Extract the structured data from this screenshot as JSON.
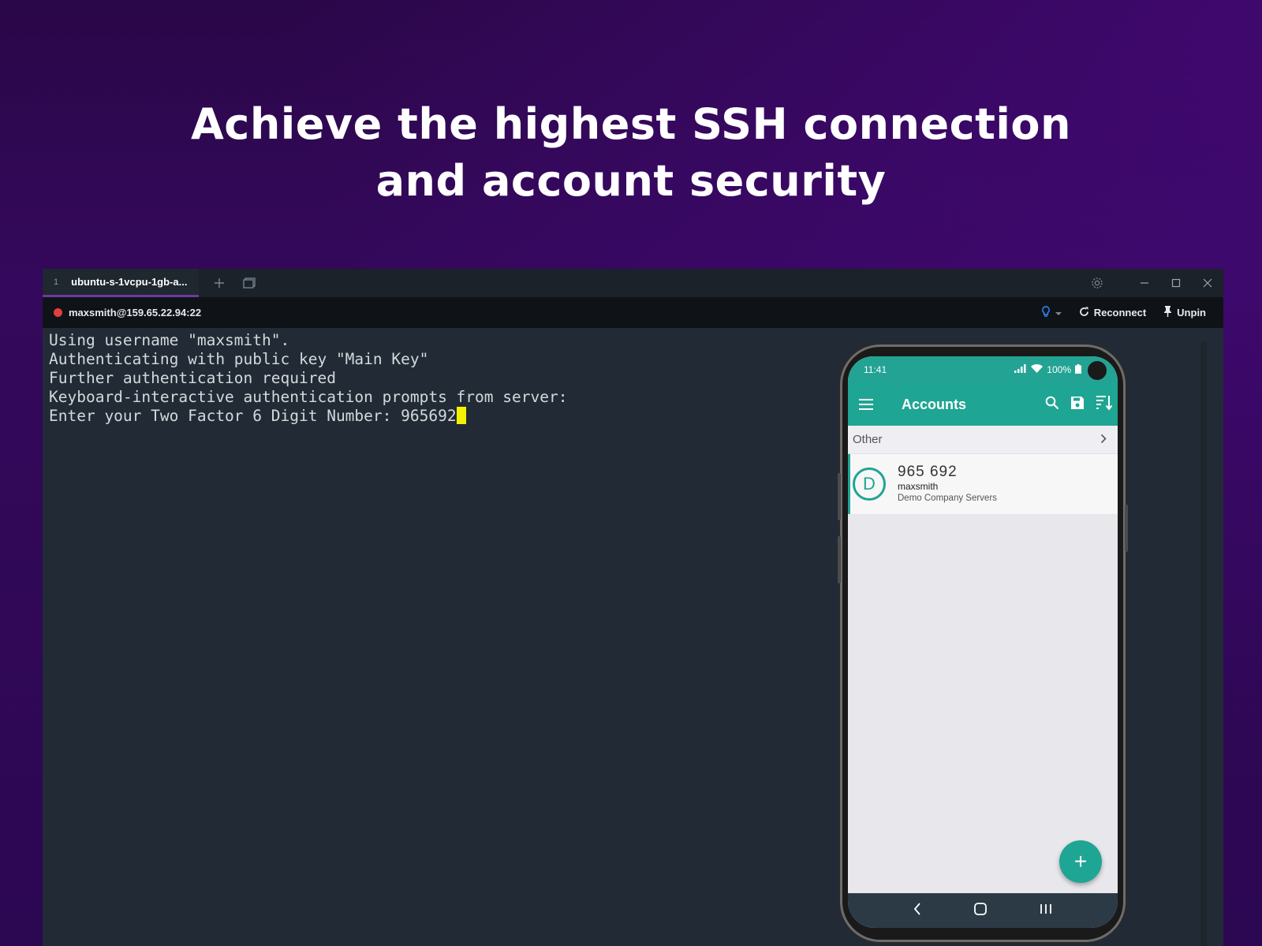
{
  "headline": {
    "line1": "Achieve the highest SSH connection",
    "line2": "and account security"
  },
  "window": {
    "tab": {
      "number": "1",
      "title": "ubuntu-s-1vcpu-1gb-a..."
    },
    "connection": "maxsmith@159.65.22.94:22",
    "reconnect_label": "Reconnect",
    "unpin_label": "Unpin",
    "terminal_lines": [
      "Using username \"maxsmith\".",
      "Authenticating with public key \"Main Key\"",
      "Further authentication required",
      "Keyboard-interactive authentication prompts from server:",
      "Enter your Two Factor 6 Digit Number: 965692"
    ]
  },
  "phone": {
    "time": "11:41",
    "battery": "100%",
    "app_title": "Accounts",
    "section_label": "Other",
    "account": {
      "avatar_letter": "D",
      "code": "965 692",
      "user": "maxsmith",
      "description": "Demo Company Servers"
    },
    "fab_label": "+"
  },
  "colors": {
    "accent": "#1fa593",
    "tab_underline": "#6c3aa0",
    "status_dot": "#e0403a",
    "cursor": "#f4f200"
  }
}
